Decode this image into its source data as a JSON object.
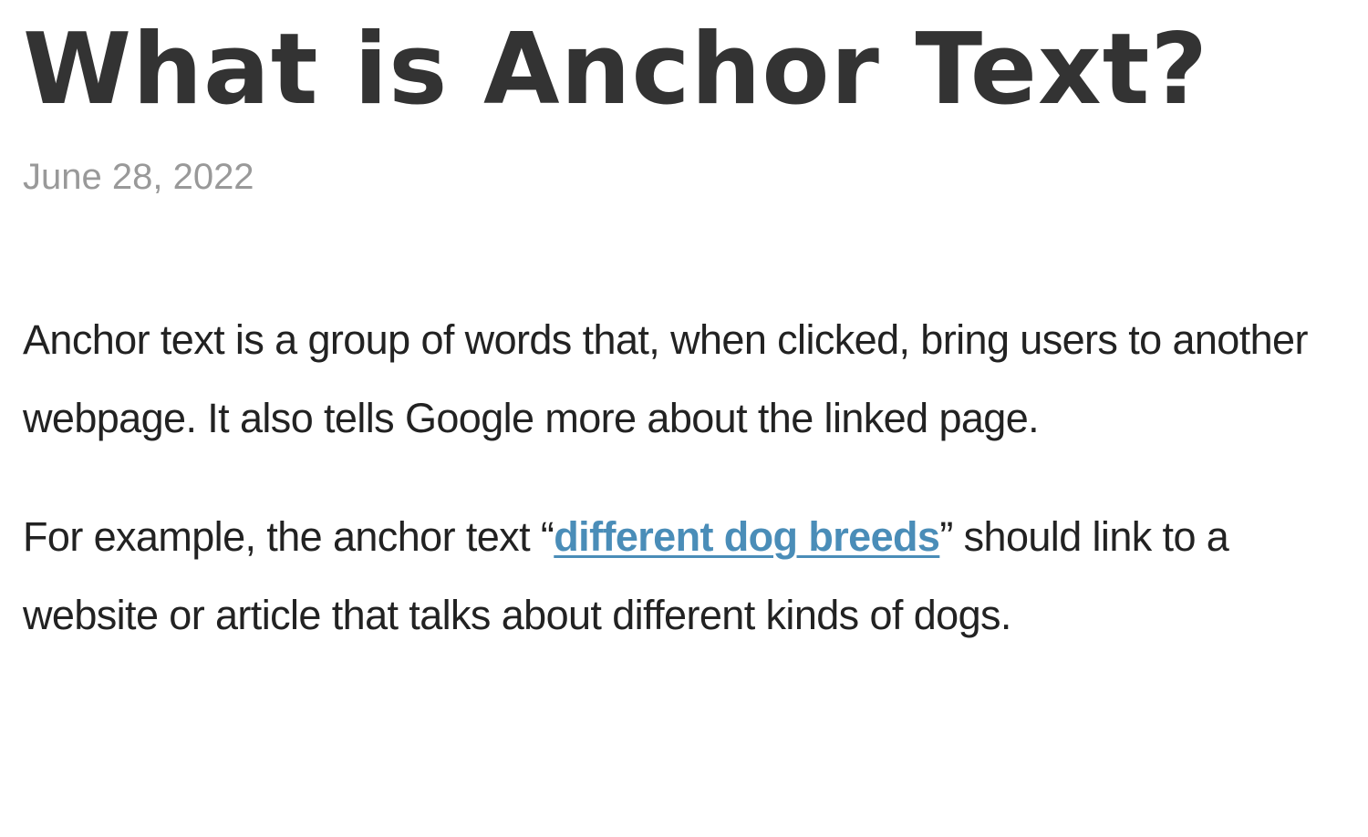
{
  "article": {
    "title": "What is Anchor Text?",
    "date": "June 28, 2022",
    "paragraph1": "Anchor text is a group of words that, when clicked, bring users to another webpage. It also tells Google more about the linked page.",
    "paragraph2": {
      "before": "For example, the anchor text “",
      "link_text": "different dog breeds",
      "after": "” should link to a website or article that talks about different kinds of dogs."
    }
  },
  "colors": {
    "title": "#333333",
    "date": "#999999",
    "body_text": "#222222",
    "link": "#4a8db8"
  }
}
